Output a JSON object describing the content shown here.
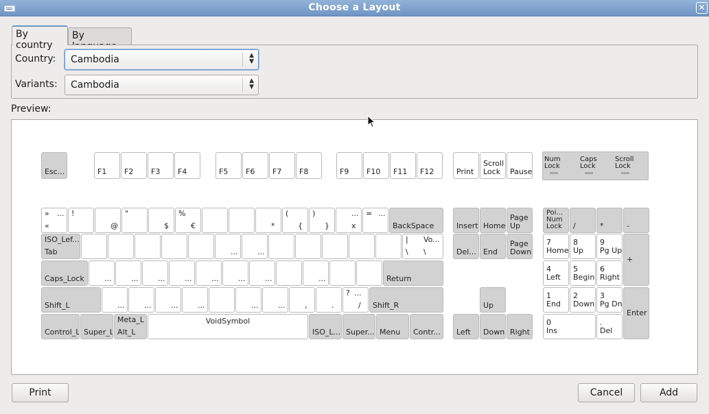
{
  "window": {
    "title": "Choose a Layout"
  },
  "tabs": [
    {
      "label": "By country"
    },
    {
      "label": "By language"
    }
  ],
  "form": {
    "country_label": "Country:",
    "country_value": "Cambodia",
    "variants_label": "Variants:",
    "variants_value": "Cambodia"
  },
  "preview": {
    "label": "Preview:"
  },
  "keyboard": {
    "fn_row": {
      "esc": "Esc...",
      "f": [
        "F1",
        "F2",
        "F3",
        "F4",
        "F5",
        "F6",
        "F7",
        "F8",
        "F9",
        "F10",
        "F11",
        "F12"
      ],
      "print": "Print",
      "scroll": "Scroll\nLock",
      "pause": "Pause"
    },
    "indicators": {
      "num": "Num\nLock",
      "caps": "Caps\nLock",
      "scroll": "Scroll\nLock"
    },
    "number_row": [
      {
        "tl": "»",
        "tr": "...",
        "bl": "«",
        "br": ""
      },
      {
        "tl": "!",
        "tr": "",
        "bl": "",
        "br": ""
      },
      {
        "tl": "",
        "tr": "",
        "bl": "",
        "br": "@"
      },
      {
        "tl": "\"",
        "tr": "",
        "bl": "",
        "br": ""
      },
      {
        "tl": "",
        "tr": "",
        "bl": "",
        "br": "$"
      },
      {
        "tl": "%",
        "tr": "",
        "bl": "",
        "br": "€"
      },
      {
        "tl": "",
        "tr": "",
        "bl": "",
        "br": ""
      },
      {
        "tl": "",
        "tr": "",
        "bl": "",
        "br": ""
      },
      {
        "tl": "",
        "tr": "",
        "bl": "",
        "br": "*"
      },
      {
        "tl": "(",
        "tr": "",
        "bl": "",
        "br": "{"
      },
      {
        "tl": ")",
        "tr": "",
        "bl": "",
        "br": "}"
      },
      {
        "tl": "",
        "tr": "...",
        "bl": "",
        "br": "x"
      },
      {
        "tl": "=",
        "tr": "...",
        "bl": "",
        "br": ""
      }
    ],
    "backspace": "BackSpace",
    "tab": {
      "top": "ISO_Lef...",
      "bottom": "Tab"
    },
    "row_q": [
      "",
      "",
      "",
      "",
      "",
      "...",
      "...",
      "",
      "",
      "",
      "",
      ""
    ],
    "backslash": {
      "tl": "|",
      "tr": "Vo...",
      "bl": "\\",
      "br": "\\"
    },
    "caps_lock": "Caps_Lock",
    "row_a": [
      "...",
      "...",
      "...",
      "...",
      "...",
      "...",
      "...",
      "",
      "...",
      ""
    ],
    "return": "Return",
    "shift_l": "Shift_L",
    "row_z": [
      "...",
      "...",
      "...",
      "...",
      "",
      "...",
      "...",
      ",",
      "."
    ],
    "slash": {
      "tl": "?",
      "tr": "...",
      "br": "/"
    },
    "shift_r": "Shift_R",
    "bottom_row": {
      "control_l": "Control_L",
      "super_l": "Super_L",
      "meta_top": "Meta_L",
      "alt_l": "Alt_L",
      "space": "VoidSymbol",
      "iso": "ISO_L...",
      "super_r": "Super...",
      "menu": "Menu",
      "control_r": "Contr..."
    },
    "nav": {
      "insert": "Insert",
      "home": "Home",
      "pgup": "Page\nUp",
      "del": "Del...",
      "end": "End",
      "pgdn": "Page\nDown",
      "up": "Up",
      "left": "Left",
      "down": "Down",
      "right": "Right"
    },
    "numpad": {
      "numlock": "Poi...\nNum\nLock",
      "div": "/",
      "mul": "*",
      "minus": "-",
      "plus": "+",
      "enter": "Enter",
      "k7": "7\nHome",
      "k8": "8\nUp",
      "k9": "9\nPg Up",
      "k4": "4\nLeft",
      "k5": "5\nBegin",
      "k6": "6\nRight",
      "k1": "1\nEnd",
      "k2": "2\nDown",
      "k3": "3\nPg Dn",
      "k0": "0\nIns",
      "kdot": ".\nDel"
    }
  },
  "buttons": {
    "print": "Print",
    "cancel": "Cancel",
    "add": "Add"
  }
}
